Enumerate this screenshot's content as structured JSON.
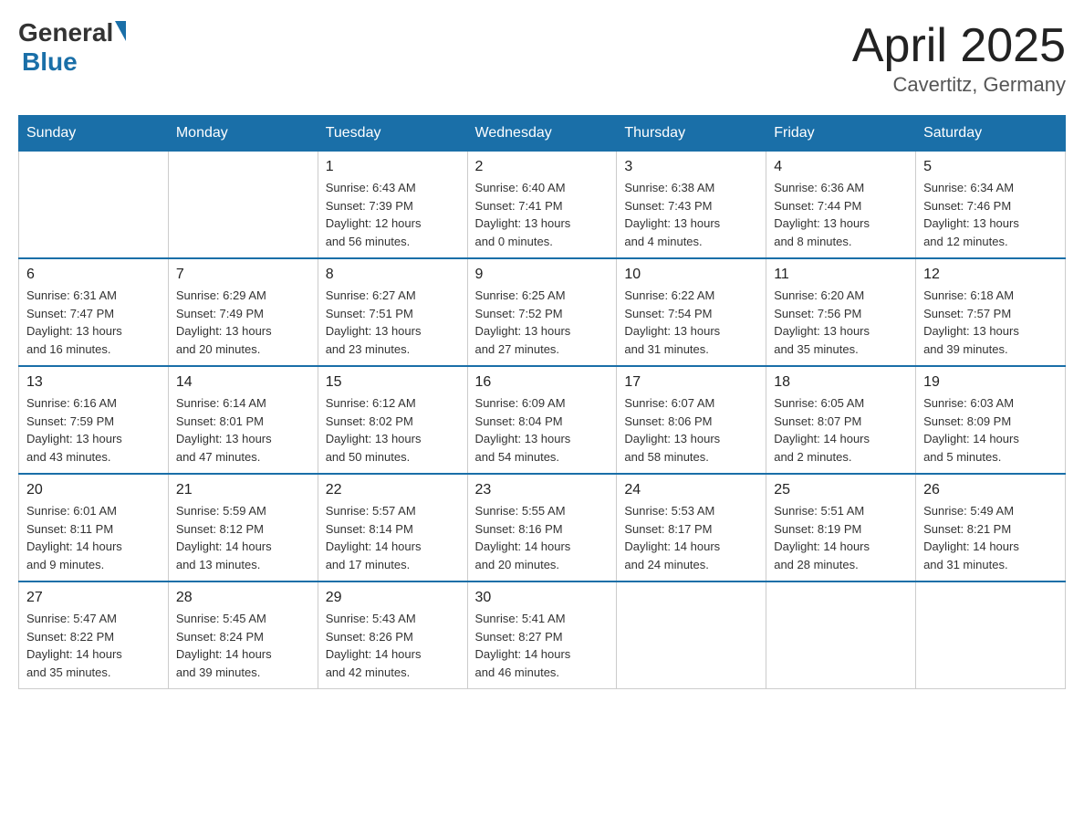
{
  "logo": {
    "general": "General",
    "blue": "Blue"
  },
  "title": "April 2025",
  "location": "Cavertitz, Germany",
  "days_of_week": [
    "Sunday",
    "Monday",
    "Tuesday",
    "Wednesday",
    "Thursday",
    "Friday",
    "Saturday"
  ],
  "weeks": [
    [
      {
        "day": "",
        "info": ""
      },
      {
        "day": "",
        "info": ""
      },
      {
        "day": "1",
        "info": "Sunrise: 6:43 AM\nSunset: 7:39 PM\nDaylight: 12 hours\nand 56 minutes."
      },
      {
        "day": "2",
        "info": "Sunrise: 6:40 AM\nSunset: 7:41 PM\nDaylight: 13 hours\nand 0 minutes."
      },
      {
        "day": "3",
        "info": "Sunrise: 6:38 AM\nSunset: 7:43 PM\nDaylight: 13 hours\nand 4 minutes."
      },
      {
        "day": "4",
        "info": "Sunrise: 6:36 AM\nSunset: 7:44 PM\nDaylight: 13 hours\nand 8 minutes."
      },
      {
        "day": "5",
        "info": "Sunrise: 6:34 AM\nSunset: 7:46 PM\nDaylight: 13 hours\nand 12 minutes."
      }
    ],
    [
      {
        "day": "6",
        "info": "Sunrise: 6:31 AM\nSunset: 7:47 PM\nDaylight: 13 hours\nand 16 minutes."
      },
      {
        "day": "7",
        "info": "Sunrise: 6:29 AM\nSunset: 7:49 PM\nDaylight: 13 hours\nand 20 minutes."
      },
      {
        "day": "8",
        "info": "Sunrise: 6:27 AM\nSunset: 7:51 PM\nDaylight: 13 hours\nand 23 minutes."
      },
      {
        "day": "9",
        "info": "Sunrise: 6:25 AM\nSunset: 7:52 PM\nDaylight: 13 hours\nand 27 minutes."
      },
      {
        "day": "10",
        "info": "Sunrise: 6:22 AM\nSunset: 7:54 PM\nDaylight: 13 hours\nand 31 minutes."
      },
      {
        "day": "11",
        "info": "Sunrise: 6:20 AM\nSunset: 7:56 PM\nDaylight: 13 hours\nand 35 minutes."
      },
      {
        "day": "12",
        "info": "Sunrise: 6:18 AM\nSunset: 7:57 PM\nDaylight: 13 hours\nand 39 minutes."
      }
    ],
    [
      {
        "day": "13",
        "info": "Sunrise: 6:16 AM\nSunset: 7:59 PM\nDaylight: 13 hours\nand 43 minutes."
      },
      {
        "day": "14",
        "info": "Sunrise: 6:14 AM\nSunset: 8:01 PM\nDaylight: 13 hours\nand 47 minutes."
      },
      {
        "day": "15",
        "info": "Sunrise: 6:12 AM\nSunset: 8:02 PM\nDaylight: 13 hours\nand 50 minutes."
      },
      {
        "day": "16",
        "info": "Sunrise: 6:09 AM\nSunset: 8:04 PM\nDaylight: 13 hours\nand 54 minutes."
      },
      {
        "day": "17",
        "info": "Sunrise: 6:07 AM\nSunset: 8:06 PM\nDaylight: 13 hours\nand 58 minutes."
      },
      {
        "day": "18",
        "info": "Sunrise: 6:05 AM\nSunset: 8:07 PM\nDaylight: 14 hours\nand 2 minutes."
      },
      {
        "day": "19",
        "info": "Sunrise: 6:03 AM\nSunset: 8:09 PM\nDaylight: 14 hours\nand 5 minutes."
      }
    ],
    [
      {
        "day": "20",
        "info": "Sunrise: 6:01 AM\nSunset: 8:11 PM\nDaylight: 14 hours\nand 9 minutes."
      },
      {
        "day": "21",
        "info": "Sunrise: 5:59 AM\nSunset: 8:12 PM\nDaylight: 14 hours\nand 13 minutes."
      },
      {
        "day": "22",
        "info": "Sunrise: 5:57 AM\nSunset: 8:14 PM\nDaylight: 14 hours\nand 17 minutes."
      },
      {
        "day": "23",
        "info": "Sunrise: 5:55 AM\nSunset: 8:16 PM\nDaylight: 14 hours\nand 20 minutes."
      },
      {
        "day": "24",
        "info": "Sunrise: 5:53 AM\nSunset: 8:17 PM\nDaylight: 14 hours\nand 24 minutes."
      },
      {
        "day": "25",
        "info": "Sunrise: 5:51 AM\nSunset: 8:19 PM\nDaylight: 14 hours\nand 28 minutes."
      },
      {
        "day": "26",
        "info": "Sunrise: 5:49 AM\nSunset: 8:21 PM\nDaylight: 14 hours\nand 31 minutes."
      }
    ],
    [
      {
        "day": "27",
        "info": "Sunrise: 5:47 AM\nSunset: 8:22 PM\nDaylight: 14 hours\nand 35 minutes."
      },
      {
        "day": "28",
        "info": "Sunrise: 5:45 AM\nSunset: 8:24 PM\nDaylight: 14 hours\nand 39 minutes."
      },
      {
        "day": "29",
        "info": "Sunrise: 5:43 AM\nSunset: 8:26 PM\nDaylight: 14 hours\nand 42 minutes."
      },
      {
        "day": "30",
        "info": "Sunrise: 5:41 AM\nSunset: 8:27 PM\nDaylight: 14 hours\nand 46 minutes."
      },
      {
        "day": "",
        "info": ""
      },
      {
        "day": "",
        "info": ""
      },
      {
        "day": "",
        "info": ""
      }
    ]
  ]
}
